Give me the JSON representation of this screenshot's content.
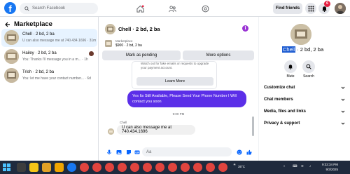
{
  "topbar": {
    "logo_glyph": "f",
    "search_placeholder": "Search Facebook",
    "find_friends": "Find friends",
    "notif_count": "6",
    "icons": [
      "home-icon",
      "groups-icon",
      "gaming-icon",
      "menu-grid-icon",
      "messenger-icon",
      "bell-icon"
    ]
  },
  "sidebar": {
    "title": "Marketplace",
    "conversations": [
      {
        "name": "Chell · 2 bd, 2 ba",
        "snippet": "U can also message me at 740.434.1696 · 31m",
        "time": "31m"
      },
      {
        "name": "Hailey · 2 bd, 2 ba",
        "snippet": "You: Thanks I'll message you in a m... · 1h",
        "time": "1h"
      },
      {
        "name": "Trish · 2 bd, 2 ba",
        "snippet": "You: let me have your contact number... · 6d",
        "time": "6d"
      }
    ]
  },
  "chat": {
    "header_name": "Chell · 2 bd, 2 ba",
    "marketplace_label": "Marketplace",
    "listing": "$900 · 2 bd, 2 ba",
    "mark_pending": "Mark as pending",
    "more_options": "More options",
    "notice_text": "Watch out for fake emails or requests to upgrade your payment account.",
    "learn_more": "Learn More",
    "outgoing_message": "Yes Its Still Available, Please Send Your Phone Number I Will contact you soon",
    "timestamp": "9:00 PM",
    "sender": "Chell",
    "incoming_message": "U can also message me at 740.434.1696",
    "composer_placeholder": "Aa"
  },
  "details": {
    "name_highlight": "Chell",
    "name_rest": " · 2 bd, 2 ba",
    "mute_label": "Mute",
    "search_label": "Search",
    "sections": [
      "Customize chat",
      "Chat members",
      "Media, files and links",
      "Privacy & support"
    ]
  },
  "taskbar": {
    "weather": "35°C",
    "time": "9:32:34 PM",
    "date": "9/3/2025"
  },
  "colors": {
    "brand": "#1877f2",
    "outgoing_bubble": "#5b2fe8",
    "selected_row": "#e7f3ff",
    "badge": "#e41e3f"
  }
}
